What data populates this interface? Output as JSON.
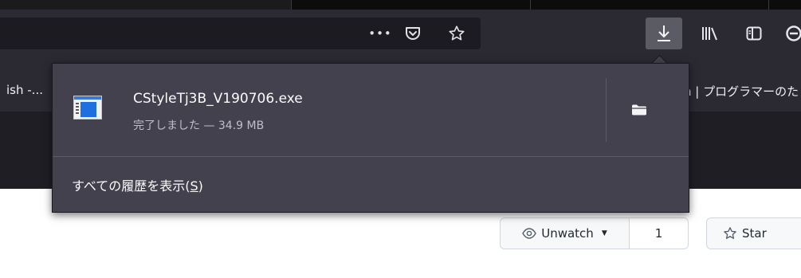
{
  "toolbar": {
    "page_actions_glyph": "•••",
    "pocket_icon": "pocket-icon",
    "bookmark_star_icon": "star-icon",
    "downloads_icon": "download-icon",
    "library_icon": "library-icon",
    "sidebar_icon": "sidebar-icon",
    "account_icon": "account-icon"
  },
  "bookmarks": {
    "left_item": "ish -...",
    "right_item": "n | プログラマーのた"
  },
  "downloads_panel": {
    "item": {
      "filename": "CStyleTj3B_V190706.exe",
      "status": "完了しました — 34.9 MB"
    },
    "show_all_label": "すべての履歴を表示(",
    "show_all_accesskey": "S",
    "show_all_close": ")"
  },
  "github": {
    "watch_label": "Unwatch",
    "watch_count": "1",
    "star_label": "Star"
  },
  "colors": {
    "toolbar_bg": "#2b2a33",
    "panel_bg": "#42414d",
    "active_button_bg": "#5b5b66",
    "file_icon_blue": "#1f6fe0"
  }
}
